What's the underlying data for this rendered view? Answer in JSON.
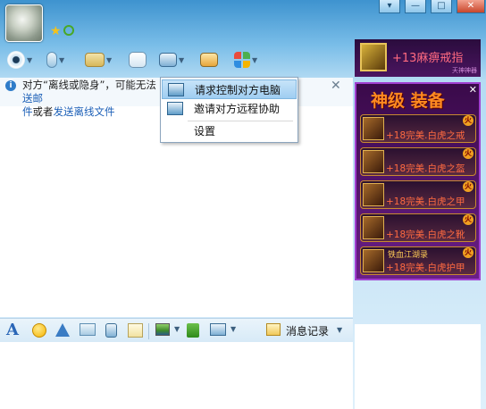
{
  "window": {
    "controls": {
      "menu": "▾",
      "minimize": "—",
      "maximize": "□",
      "close": "✕"
    }
  },
  "toolbar": {
    "icons": [
      "video-icon",
      "voice-icon",
      "file-transfer-icon",
      "add-contact-icon",
      "remote-assist-icon",
      "share-screen-icon",
      "apps-grid-icon"
    ]
  },
  "notice": {
    "text_before": "对方“离线或隐身”，可能无法",
    "link1": "送邮",
    "line2_link1": "件",
    "line2_middle": "或者",
    "line2_link2": "发送离线文件",
    "close": "✕"
  },
  "menu": {
    "items": [
      {
        "label": "请求控制对方电脑",
        "icon": "remote-control-icon"
      },
      {
        "label": "邀请对方远程协助",
        "icon": "invite-assist-icon"
      },
      {
        "label": "设置"
      }
    ]
  },
  "ad_top": {
    "text": "+13麻痹戒指",
    "sub": "天神神器"
  },
  "ad_box": {
    "title": "神级 装备",
    "close": "✕",
    "rows": [
      {
        "text": "+18完美.白虎之戒",
        "badge": "火"
      },
      {
        "text": "+18完美.白虎之盔",
        "badge": "火"
      },
      {
        "text": "+18完美.白虎之甲",
        "badge": "火"
      },
      {
        "text": "+18完美.白虎之靴",
        "badge": "火"
      },
      {
        "text": "+18完美.白虎护甲",
        "badge": "火",
        "sub": "铁血江湖录"
      }
    ]
  },
  "format_bar": {
    "font_icon": "A",
    "history_label": "消息记录"
  },
  "colors": {
    "link": "#1b5fb7",
    "ad_text": "#ff6a40",
    "menu_highlight": "#9fcdf1"
  }
}
